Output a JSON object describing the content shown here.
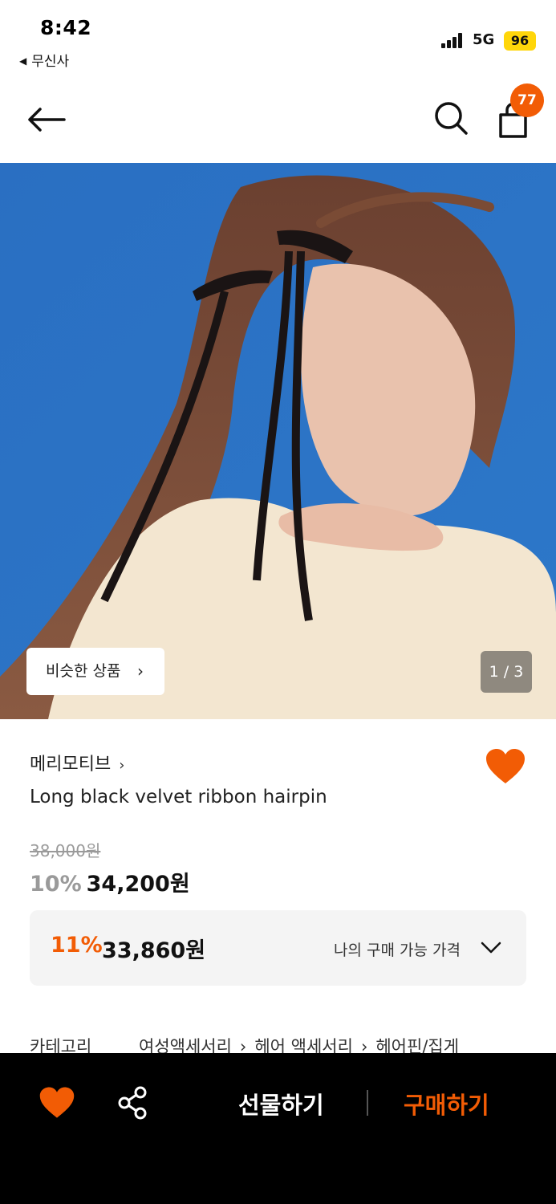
{
  "status_bar": {
    "time": "8:42",
    "back_app": "무신사",
    "network": "5G",
    "battery": "96"
  },
  "header": {
    "cart_count": "77",
    "icons": [
      "back-arrow-icon",
      "search-icon",
      "shopping-bag-icon"
    ]
  },
  "gallery": {
    "similar_button": "비슷한 상품",
    "page_indicator": "1 / 3"
  },
  "product": {
    "brand": "메리모티브",
    "name": "Long black velvet ribbon hairpin",
    "original_price": "38,000원",
    "discount": "10%",
    "sale_price": "34,200원",
    "liked": true
  },
  "member_price": {
    "discount": "11%",
    "price": "33,860원",
    "label": "나의 구매 가능 가격"
  },
  "category": {
    "label": "카테고리",
    "path": [
      "여성액세서리",
      "헤어 액세서리",
      "헤어핀/집게"
    ]
  },
  "bottom_bar": {
    "gift": "선물하기",
    "buy": "구매하기"
  },
  "colors": {
    "accent": "#f25c05",
    "hero_background": "#2c73c5",
    "bottom_bar": "#000000"
  }
}
